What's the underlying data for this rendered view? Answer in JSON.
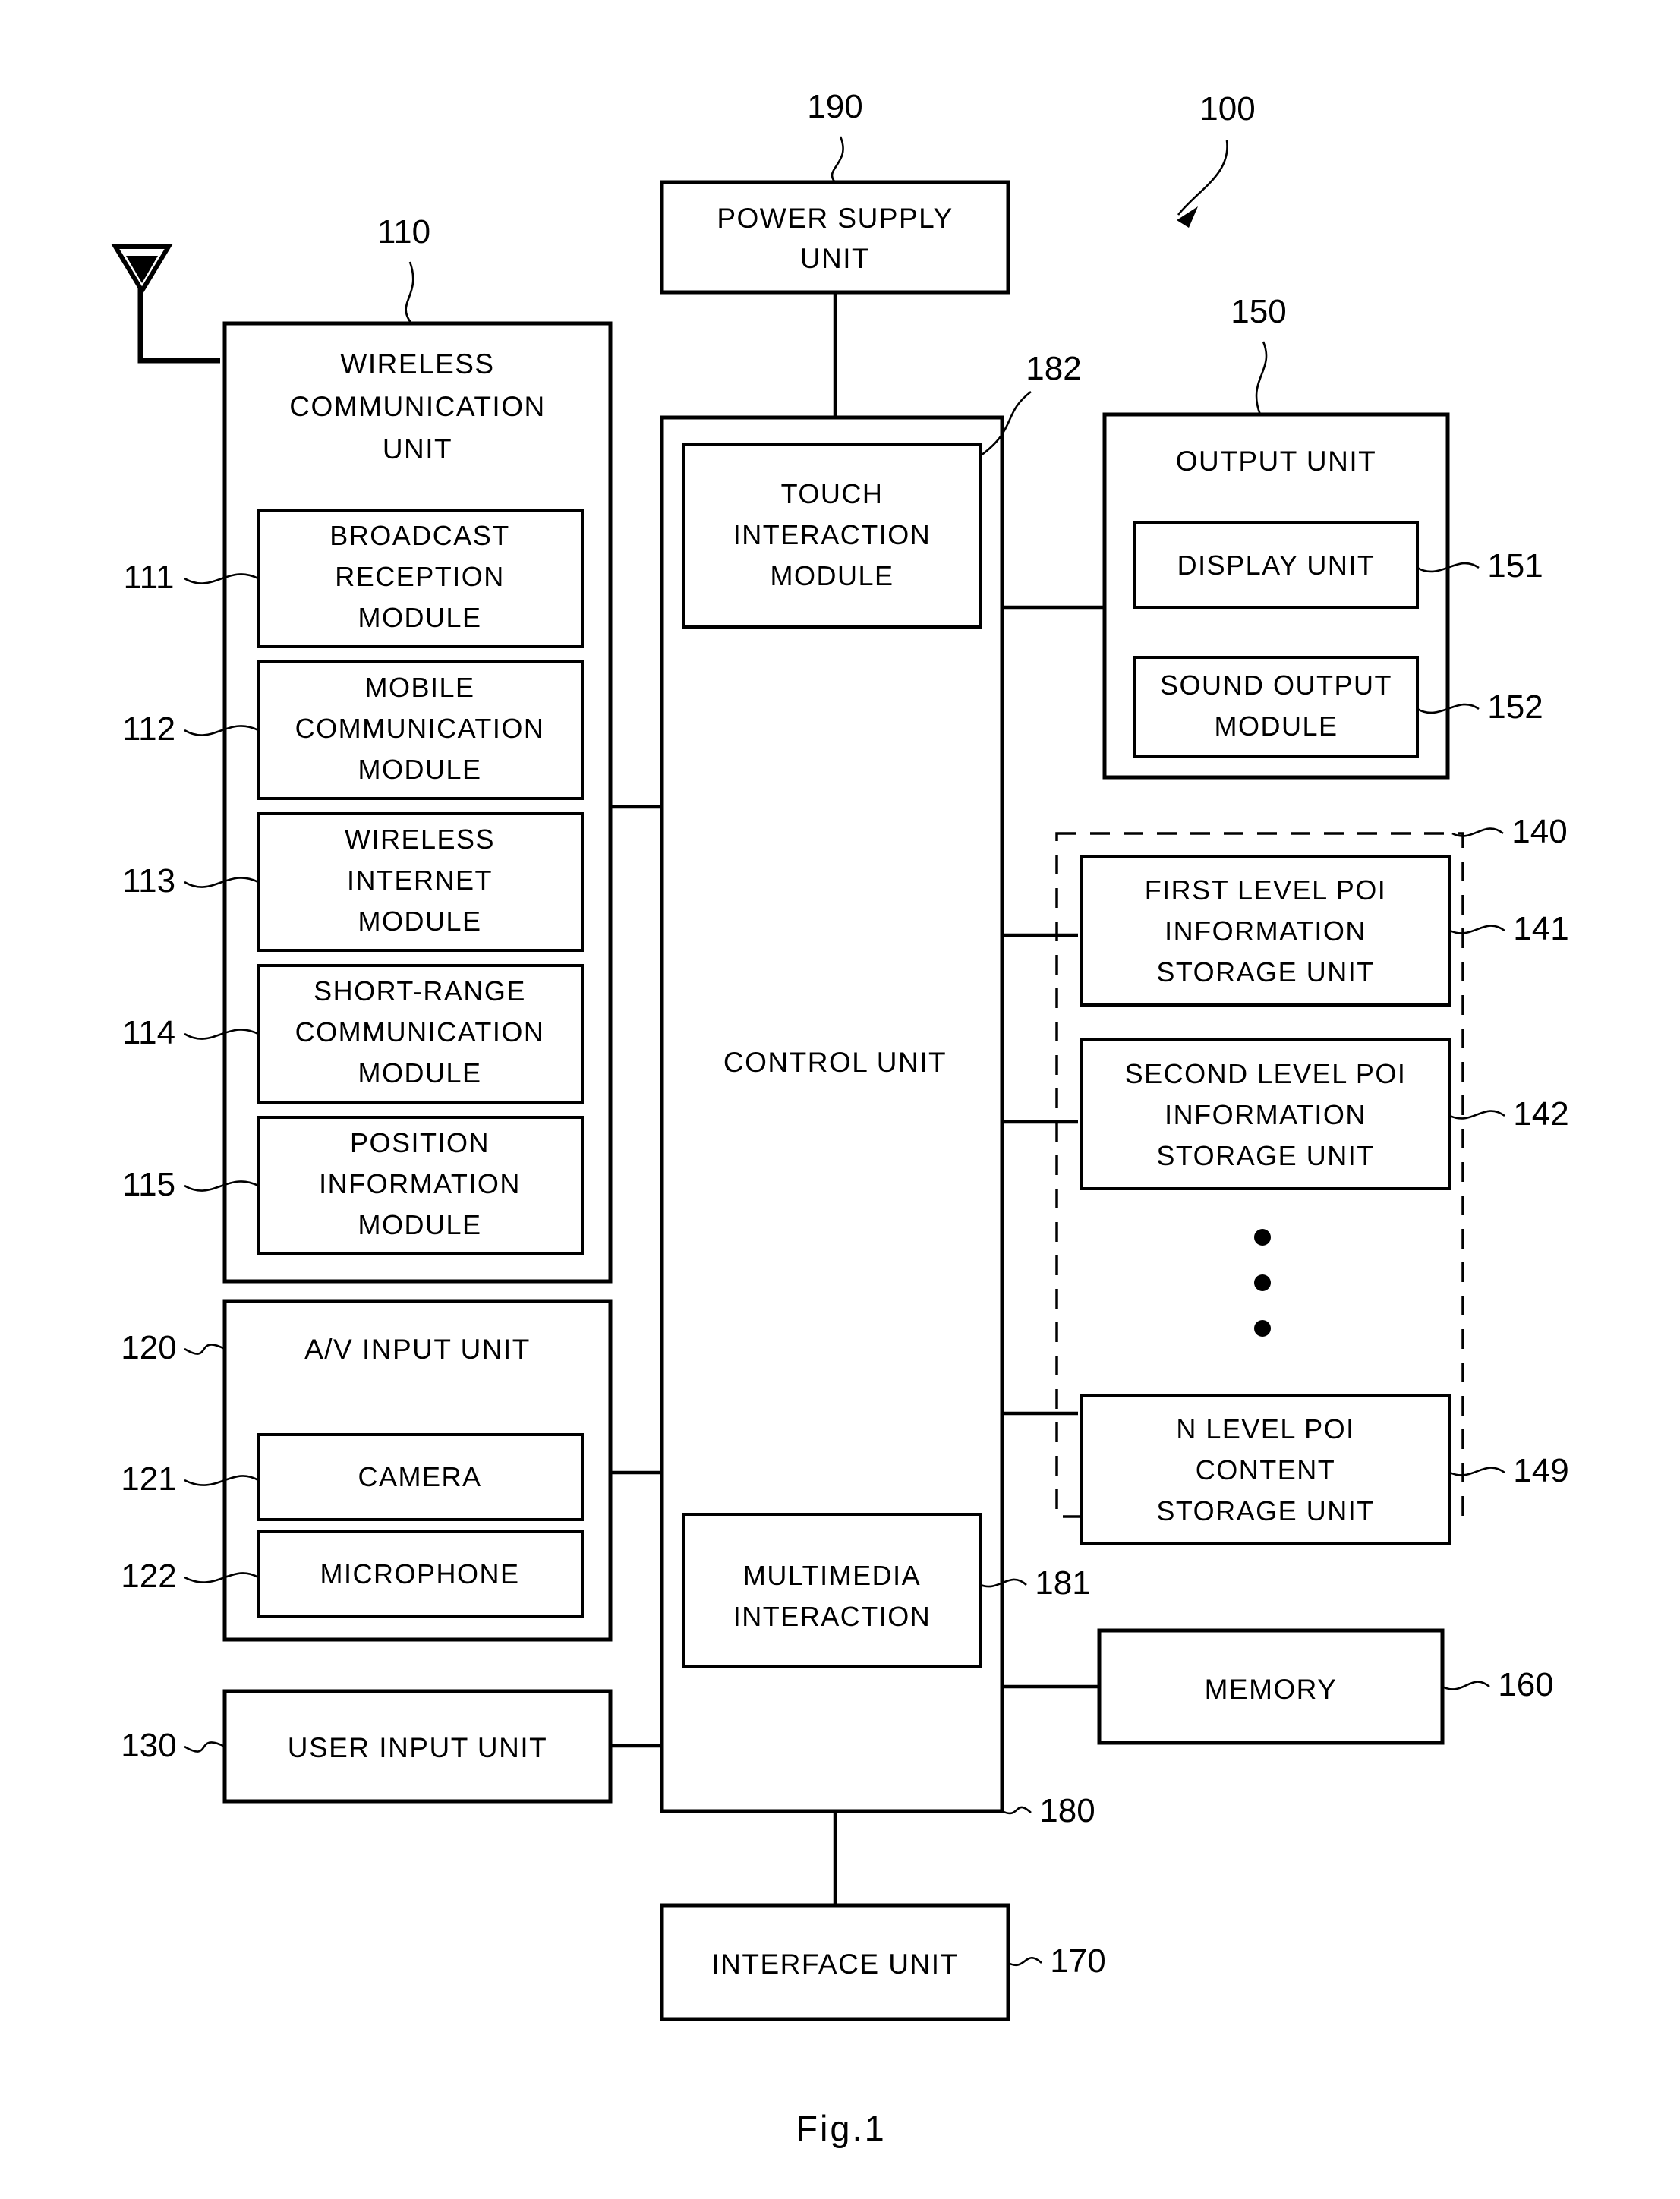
{
  "figure": {
    "caption": "Fig.1",
    "overall_ref": "100"
  },
  "blocks": {
    "wireless_communication_unit": {
      "label_line1": "WIRELESS",
      "label_line2": "COMMUNICATION",
      "label_line3": "UNIT",
      "ref": "110",
      "modules": [
        {
          "ref": "111",
          "lines": [
            "BROADCAST",
            "RECEPTION",
            "MODULE"
          ]
        },
        {
          "ref": "112",
          "lines": [
            "MOBILE",
            "COMMUNICATION",
            "MODULE"
          ]
        },
        {
          "ref": "113",
          "lines": [
            "WIRELESS",
            "INTERNET",
            "MODULE"
          ]
        },
        {
          "ref": "114",
          "lines": [
            "SHORT-RANGE",
            "COMMUNICATION",
            "MODULE"
          ]
        },
        {
          "ref": "115",
          "lines": [
            "POSITION",
            "INFORMATION",
            "MODULE"
          ]
        }
      ]
    },
    "av_input_unit": {
      "label": "A/V INPUT UNIT",
      "ref": "120",
      "modules": [
        {
          "ref": "121",
          "lines": [
            "CAMERA"
          ]
        },
        {
          "ref": "122",
          "lines": [
            "MICROPHONE"
          ]
        }
      ]
    },
    "user_input_unit": {
      "label": "USER INPUT UNIT",
      "ref": "130"
    },
    "power_supply_unit": {
      "label_line1": "POWER SUPPLY",
      "label_line2": "UNIT",
      "ref": "190"
    },
    "control_unit": {
      "label": "CONTROL UNIT",
      "ref": "180"
    },
    "touch_interaction_module": {
      "label_line1": "TOUCH",
      "label_line2": "INTERACTION",
      "label_line3": "MODULE",
      "ref": "182"
    },
    "multimedia_interaction": {
      "label_line1": "MULTIMEDIA",
      "label_line2": "INTERACTION",
      "ref": "181"
    },
    "output_unit": {
      "label": "OUTPUT UNIT",
      "ref": "150",
      "modules": [
        {
          "ref": "151",
          "lines": [
            "DISPLAY UNIT"
          ]
        },
        {
          "ref": "152",
          "lines": [
            "SOUND OUTPUT",
            "MODULE"
          ]
        }
      ]
    },
    "poi_storage_group": {
      "ref": "140",
      "modules": [
        {
          "ref": "141",
          "lines": [
            "FIRST LEVEL POI",
            "INFORMATION",
            "STORAGE UNIT"
          ]
        },
        {
          "ref": "142",
          "lines": [
            "SECOND LEVEL POI",
            "INFORMATION",
            "STORAGE UNIT"
          ]
        },
        {
          "ref": "149",
          "lines": [
            "N LEVEL POI",
            "CONTENT",
            "STORAGE UNIT"
          ]
        }
      ],
      "ellipsis": "vertical-dots"
    },
    "memory": {
      "label": "MEMORY",
      "ref": "160"
    },
    "interface_unit": {
      "label": "INTERFACE UNIT",
      "ref": "170"
    }
  },
  "icons": {
    "antenna": "antenna-icon",
    "pointer_arrow": "arrow-icon"
  },
  "colors": {
    "line": "#000000",
    "background": "#ffffff"
  }
}
